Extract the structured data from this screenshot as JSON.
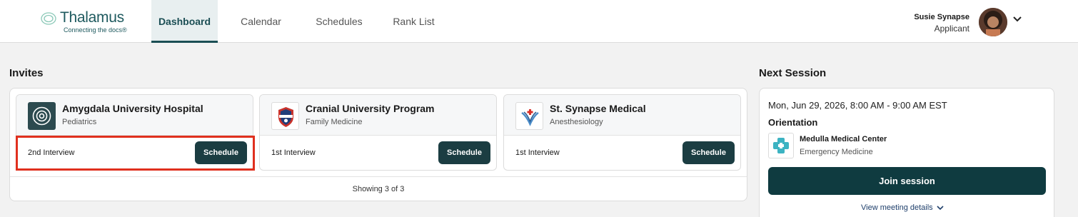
{
  "header": {
    "brand": "Thalamus",
    "tagline": "Connecting the docs®",
    "nav": [
      "Dashboard",
      "Calendar",
      "Schedules",
      "Rank List"
    ],
    "user_name": "Susie Synapse",
    "user_role": "Applicant"
  },
  "invites": {
    "title": "Invites",
    "cards": [
      {
        "name": "Amygdala University Hospital",
        "specialty": "Pediatrics",
        "round": "2nd Interview",
        "button": "Schedule"
      },
      {
        "name": "Cranial University Program",
        "specialty": "Family Medicine",
        "round": "1st Interview",
        "button": "Schedule"
      },
      {
        "name": "St. Synapse Medical",
        "specialty": "Anesthesiology",
        "round": "1st Interview",
        "button": "Schedule"
      }
    ],
    "footer": "Showing 3 of 3"
  },
  "session": {
    "title": "Next Session",
    "date": "Mon, Jun 29, 2026, 8:00 AM - 9:00 AM EST",
    "type": "Orientation",
    "org": "Medulla Medical Center",
    "dept": "Emergency Medicine",
    "join": "Join session",
    "details": "View meeting details"
  },
  "colors": {
    "brand": "#1f5a5f",
    "button": "#1b3d42",
    "highlight": "#e0301e"
  }
}
